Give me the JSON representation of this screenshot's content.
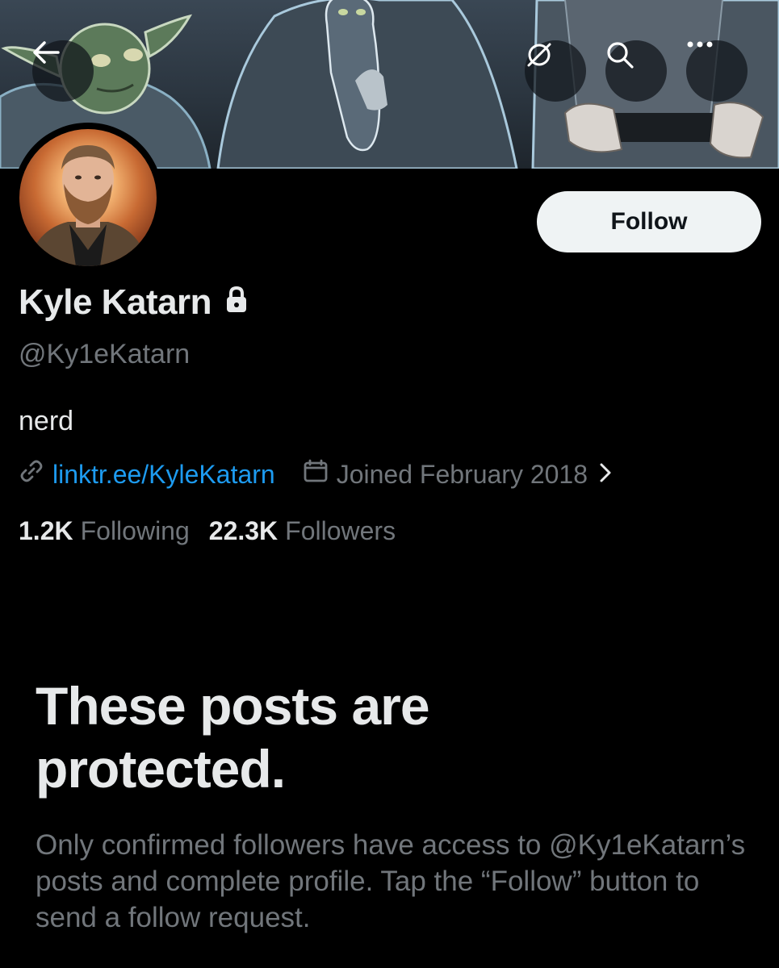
{
  "header": {
    "back_icon": "arrow-left-icon",
    "mute_icon": "mute-icon",
    "search_icon": "search-icon",
    "more_icon": "more-icon"
  },
  "profile": {
    "display_name": "Kyle Katarn",
    "handle": "@Ky1eKatarn",
    "bio": "nerd",
    "link_text": "linktr.ee/KyleKatarn",
    "joined": "Joined February 2018",
    "following_count": "1.2K",
    "following_label": "Following",
    "followers_count": "22.3K",
    "followers_label": "Followers",
    "follow_button": "Follow"
  },
  "protected": {
    "title": "These posts are protected.",
    "description": "Only confirmed followers have access to @Ky1eKatarn’s posts and complete profile. Tap the “Follow” button to send a follow request."
  },
  "colors": {
    "background": "#000000",
    "text_primary": "#e7e9ea",
    "text_secondary": "#71767b",
    "link": "#1d9bf0",
    "button_bg": "#eff3f4"
  }
}
